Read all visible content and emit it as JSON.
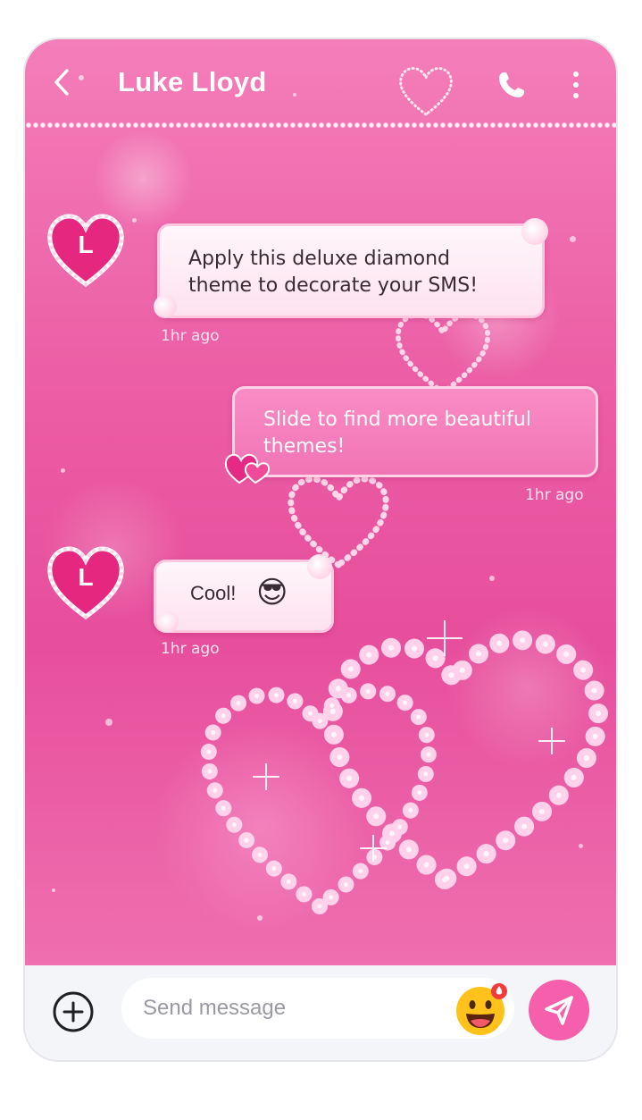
{
  "header": {
    "contact_name": "Luke Lloyd",
    "back_icon": "chevron-left-icon",
    "call_icon": "phone-icon",
    "menu_icon": "more-vertical-icon"
  },
  "messages": [
    {
      "direction": "incoming",
      "avatar_letter": "L",
      "text_line1": "Apply this deluxe diamond",
      "text_line2": "theme to decorate your SMS!",
      "time": "1hr ago"
    },
    {
      "direction": "outgoing",
      "text_line1": "Slide to find more beautiful",
      "text_line2": "themes!",
      "time": "1hr ago"
    },
    {
      "direction": "incoming",
      "avatar_letter": "L",
      "text": "Cool!",
      "emoji": "😎",
      "time": "1hr ago"
    }
  ],
  "composer": {
    "add_icon": "plus-circle-icon",
    "placeholder": "Send message",
    "emoji_icon": "emoji-face-icon",
    "send_icon": "send-icon"
  },
  "colors": {
    "accent": "#f55fab",
    "background_pink": "#ec5fa6",
    "bubble_out": "#f174b5",
    "bubble_in": "#fde2ef"
  }
}
